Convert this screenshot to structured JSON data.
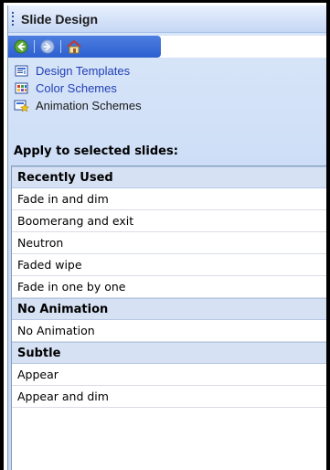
{
  "pane": {
    "title": "Slide Design"
  },
  "nav": {
    "back": "back",
    "forward": "forward",
    "home": "home"
  },
  "tasks": [
    {
      "label": "Design Templates",
      "icon": "design-templates-icon",
      "link": true
    },
    {
      "label": "Color Schemes",
      "icon": "color-schemes-icon",
      "link": true
    },
    {
      "label": "Animation Schemes",
      "icon": "animation-schemes-icon",
      "link": false
    }
  ],
  "apply_label": "Apply to selected slides:",
  "list": {
    "groups": [
      {
        "header": "Recently Used",
        "items": [
          "Fade in and dim",
          "Boomerang and exit",
          "Neutron",
          "Faded wipe",
          "Fade in one by one"
        ]
      },
      {
        "header": "No Animation",
        "items": [
          "No Animation"
        ]
      },
      {
        "header": "Subtle",
        "items": [
          "Appear",
          "Appear and dim"
        ]
      }
    ]
  },
  "colors": {
    "accent": "#2d5fcf",
    "link": "#1f3fb5",
    "group_header_bg": "#d6e1f3",
    "pane_bg": "#cfdff7"
  }
}
